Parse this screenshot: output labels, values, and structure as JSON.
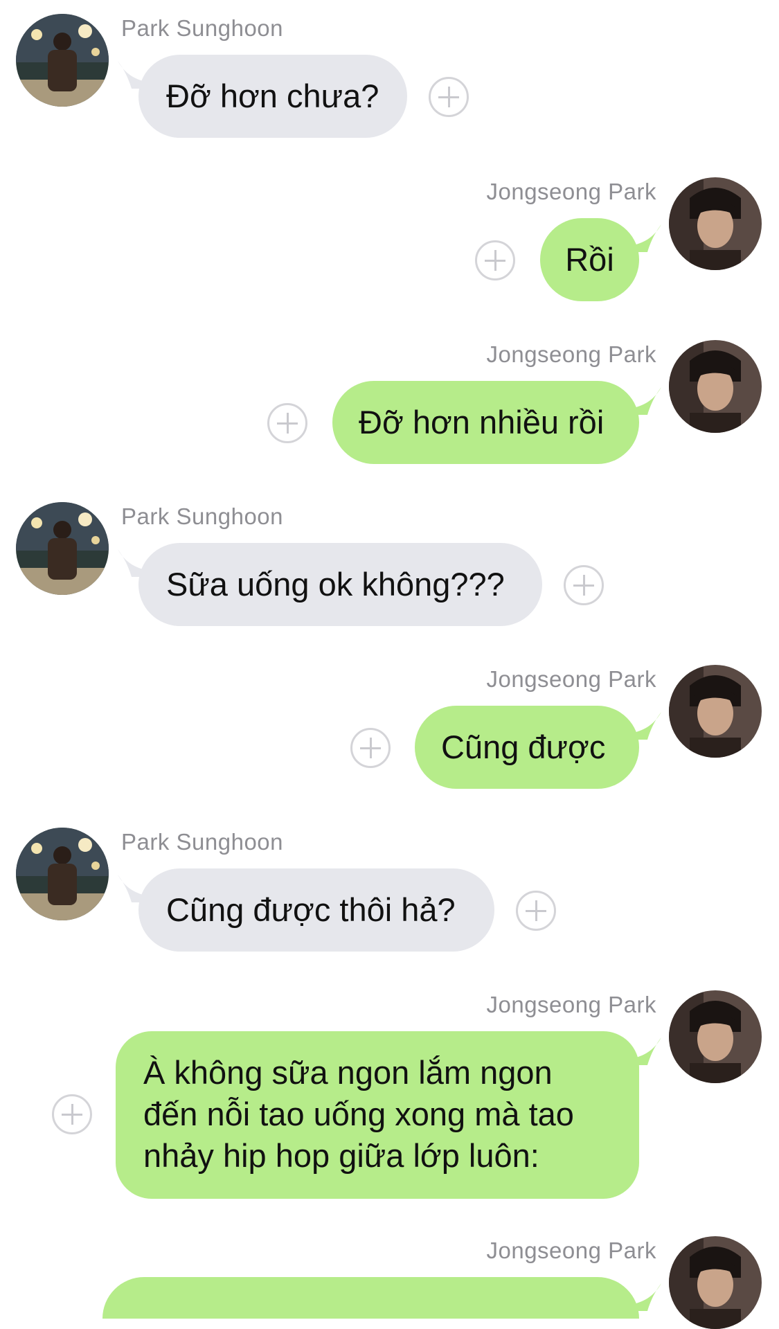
{
  "messages": [
    {
      "sender": "Park Sunghoon",
      "side": "left",
      "text": "Đỡ hơn chưa?"
    },
    {
      "sender": "Jongseong Park",
      "side": "right",
      "text": "Rồi"
    },
    {
      "sender": "Jongseong Park",
      "side": "right",
      "text": "Đỡ hơn nhiều rồi"
    },
    {
      "sender": "Park Sunghoon",
      "side": "left",
      "text": "Sữa uống ok không???"
    },
    {
      "sender": "Jongseong Park",
      "side": "right",
      "text": "Cũng được"
    },
    {
      "sender": "Park Sunghoon",
      "side": "left",
      "text": "Cũng được thôi hả?"
    },
    {
      "sender": "Jongseong Park",
      "side": "right",
      "text": "À không sữa ngon lắm ngon đến nỗi tao uống xong mà tao nhảy hip hop giữa lớp luôn:"
    },
    {
      "sender": "Jongseong Park",
      "side": "right",
      "text": ""
    }
  ],
  "colors": {
    "incoming_bubble": "#e6e7ec",
    "outgoing_bubble": "#b6ec8a",
    "sender_name": "#8e8e93"
  },
  "icons": {
    "react": "plus-circle-icon"
  }
}
